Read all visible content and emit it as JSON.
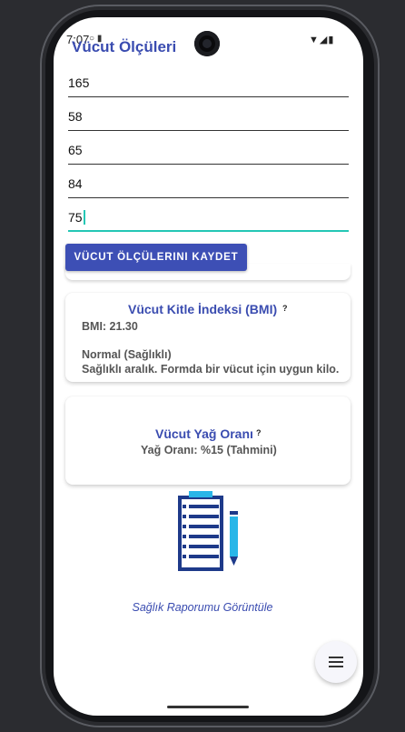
{
  "status_bar": {
    "time": "7:07",
    "left_icons": "○ ▮",
    "right_icons": "▼◢▮"
  },
  "app": {
    "title": "Vücut Ölçüleri"
  },
  "form": {
    "fields": [
      {
        "value": "165"
      },
      {
        "value": "58"
      },
      {
        "value": "65"
      },
      {
        "value": "84"
      },
      {
        "value": "75"
      }
    ],
    "save_label": "VÜCUT ÖLÇÜLERINI KAYDET"
  },
  "bmi_card": {
    "title": "Vücut Kitle İndeksi (BMI)",
    "help": "?",
    "value_text": "BMI: 21.30",
    "category": "Normal (Sağlıklı)",
    "description": "Sağlıklı aralık. Formda bir vücut için uygun kilo."
  },
  "fat_card": {
    "title": "Vücut Yağ Oranı",
    "help": "?",
    "value_text": "Yağ Oranı: %15 (Tahmini)"
  },
  "report": {
    "icon": "clipboard-checklist-icon",
    "link_label": "Sağlık Raporumu Görüntüle"
  },
  "fab": {
    "icon": "menu-icon"
  },
  "colors": {
    "primary": "#3d4fb5",
    "accent": "#24c7b5",
    "report_icon": "#1e3a8a",
    "pencil": "#29b6e8"
  }
}
